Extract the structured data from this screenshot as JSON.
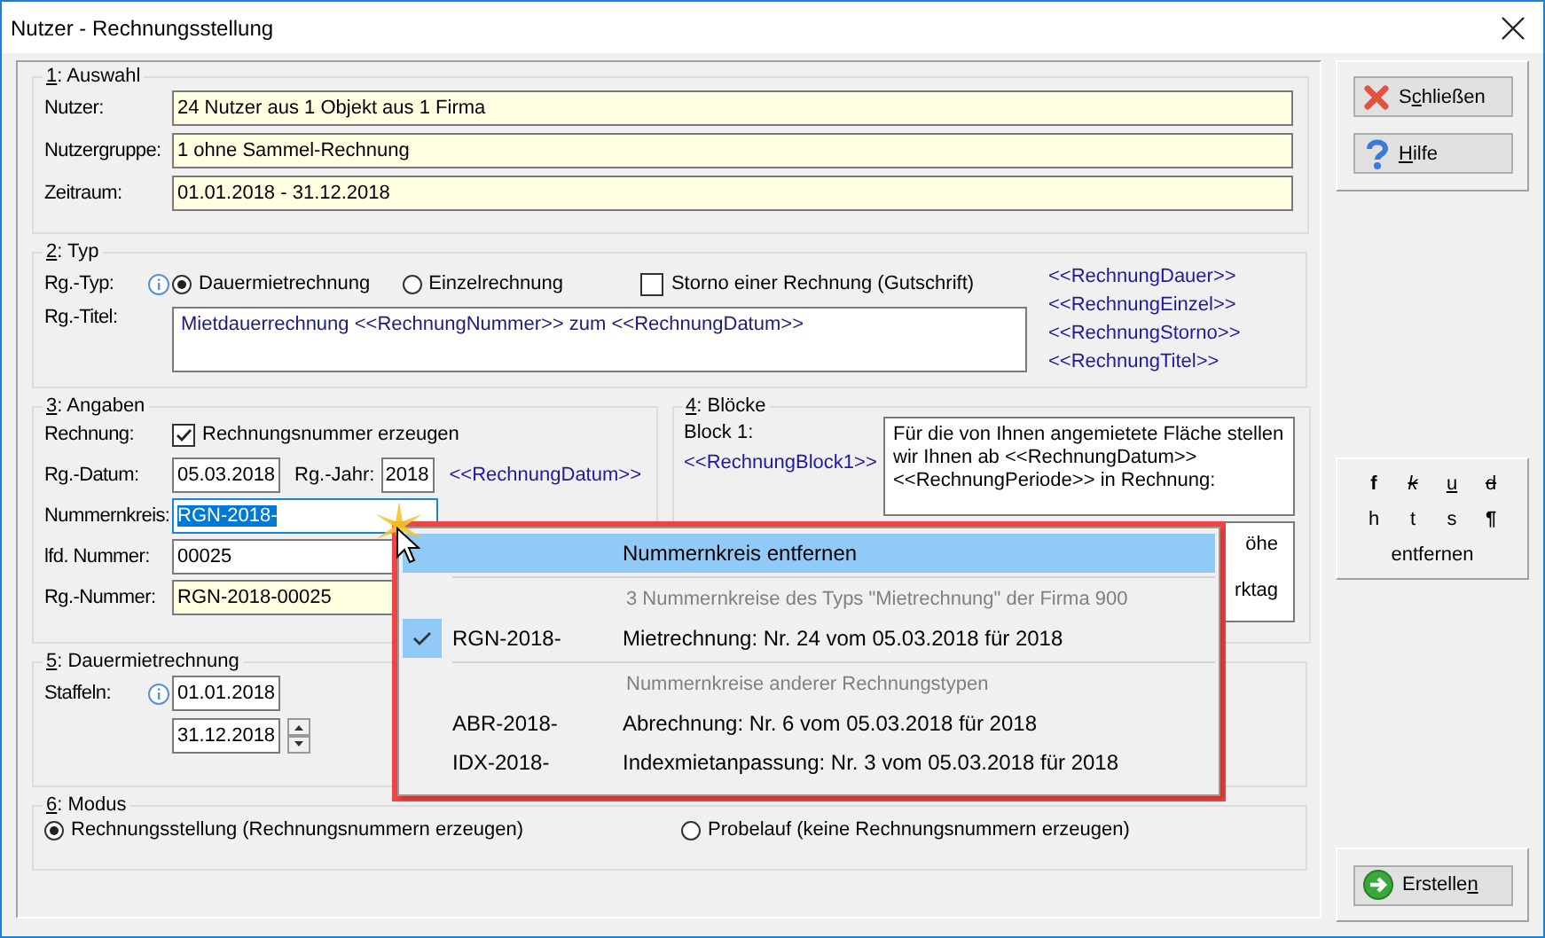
{
  "window": {
    "title": "Nutzer - Rechnungsstellung"
  },
  "auswahl": {
    "legend": {
      "key": "1",
      "rest": ": Auswahl"
    },
    "fields": [
      {
        "label": "Nutzer:",
        "value": "24 Nutzer aus 1 Objekt aus 1 Firma"
      },
      {
        "label": "Nutzergruppe:",
        "value": "1 ohne Sammel-Rechnung"
      },
      {
        "label": "Zeitraum:",
        "value": "01.01.2018 - 31.12.2018"
      }
    ]
  },
  "typ": {
    "legend": {
      "key": "2",
      "rest": ": Typ"
    },
    "type_label": "Rg.-Typ:",
    "options": [
      {
        "label": "Dauermietrechnung",
        "selected": true
      },
      {
        "label": "Einzelrechnung",
        "selected": false
      }
    ],
    "storno": {
      "label": "Storno einer Rechnung (Gutschrift)",
      "checked": false
    },
    "title_label": "Rg.-Titel:",
    "title_value": "Mietdauerrechnung <<RechnungNummer>> zum <<RechnungDatum>>",
    "variables": [
      "<<RechnungDauer>>",
      "<<RechnungEinzel>>",
      "<<RechnungStorno>>",
      "<<RechnungTitel>>"
    ]
  },
  "angaben": {
    "legend": {
      "key": "3",
      "rest": ": Angaben"
    },
    "rechnung_label": "Rechnung:",
    "generate": {
      "label": "Rechnungsnummer erzeugen",
      "checked": true
    },
    "datum_label": "Rg.-Datum:",
    "datum": "05.03.2018",
    "jahr_label": "Rg.-Jahr:",
    "jahr": "2018",
    "datum_variable": "<<RechnungDatum>>",
    "nummernkreis_label": "Nummernkreis:",
    "nummernkreis": {
      "value": "RGN-2018-",
      "selected": true
    },
    "lfd_label": "lfd. Nummer:",
    "lfd": "00025",
    "nummer_label": "Rg.-Nummer:",
    "nummer": "RGN-2018-00025"
  },
  "bloecke": {
    "legend": {
      "key": "4",
      "rest": ": Blöcke"
    },
    "block_label": "Block 1:",
    "block_variable": "<<RechnungBlock1>>",
    "block_1_lines": [
      "Für die von Ihnen angemietete Fläche stellen",
      "wir Ihnen ab <<RechnungDatum>>",
      "<<RechnungPeriode>> in Rechnung:"
    ],
    "block_2_lines": [
      "öhe",
      "rktag"
    ]
  },
  "dauermiete": {
    "legend": {
      "key": "5",
      "rest": ": Dauermietrechnung"
    },
    "label": "Staffeln:",
    "dates": [
      "01.01.2018",
      "31.12.2018"
    ]
  },
  "modus": {
    "legend": {
      "key": "6",
      "rest": ": Modus"
    },
    "options": [
      {
        "label": "Rechnungsstellung (Rechnungsnummern erzeugen)",
        "selected": true
      },
      {
        "label": "Probelauf (keine Rechnungsnummern erzeugen)",
        "selected": false
      }
    ]
  },
  "side_buttons": [
    {
      "kind": "close",
      "pre": "S",
      "key": "c",
      "post": "hließen"
    },
    {
      "kind": "help",
      "key": "H",
      "post": "ilfe"
    }
  ],
  "format": {
    "tools": [
      {
        "label": "f",
        "kind": "bold"
      },
      {
        "label": "k",
        "kind": "italic"
      },
      {
        "label": "u",
        "kind": "underline"
      },
      {
        "label": "d",
        "kind": "strike"
      },
      {
        "label": "h",
        "kind": "plain"
      },
      {
        "label": "t",
        "kind": "plain"
      },
      {
        "label": "s",
        "kind": "plain"
      },
      {
        "label": "¶",
        "kind": "bold"
      }
    ],
    "remove": "entfernen"
  },
  "create_button": {
    "pre": "Erstelle",
    "key": "n"
  },
  "menu": {
    "remove": {
      "label": "Nummernkreis entfernen",
      "selected": true
    },
    "groups": [
      {
        "header": "3 Nummernkreise des Typs \"Mietrechnung\" der Firma 900",
        "items": [
          {
            "code": "RGN-2018-",
            "description": "Mietrechnung: Nr. 24 vom 05.03.2018 für 2018",
            "checked": true
          }
        ]
      },
      {
        "header": "Nummernkreise anderer Rechnungstypen",
        "items": [
          {
            "code": "ABR-2018-",
            "description": "Abrechnung: Nr. 6 vom 05.03.2018 für 2018",
            "checked": false
          },
          {
            "code": "IDX-2018-",
            "description": "Indexmietanpassung: Nr. 3 vom 05.03.2018 für 2018",
            "checked": false
          }
        ]
      }
    ]
  }
}
